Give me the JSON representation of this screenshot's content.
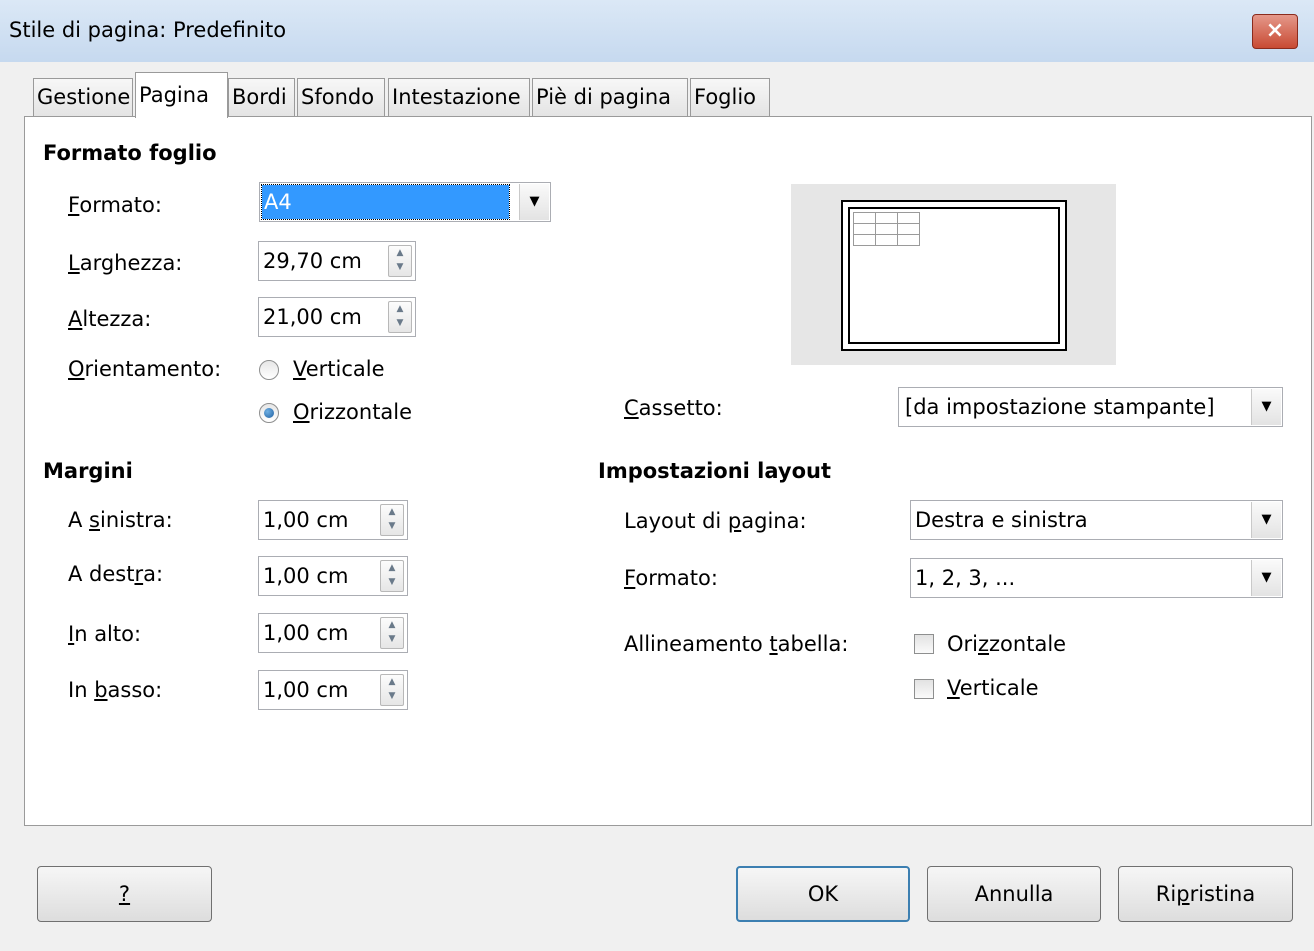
{
  "window": {
    "title": "Stile di pagina: Predefinito",
    "close_glyph": "×"
  },
  "tabs": [
    {
      "label": "Gestione",
      "active": false
    },
    {
      "label": "Pagina",
      "active": true
    },
    {
      "label": "Bordi",
      "active": false
    },
    {
      "label": "Sfondo",
      "active": false
    },
    {
      "label": "Intestazione",
      "active": false
    },
    {
      "label": "Piè di pagina",
      "active": false
    },
    {
      "label": "Foglio",
      "active": false
    }
  ],
  "paper": {
    "heading": "Formato foglio",
    "format": {
      "label_key": "F",
      "label_rest": "ormato:",
      "value": "A4"
    },
    "width": {
      "label_key": "L",
      "label_rest": "arghezza:",
      "value": "29,70 cm"
    },
    "height": {
      "label_key": "A",
      "label_rest": "ltezza:",
      "value": "21,00 cm"
    },
    "orientation": {
      "label_key": "O",
      "label_rest": "rientamento:",
      "portrait_key": "V",
      "portrait_rest": "erticale",
      "landscape_key": "O",
      "landscape_rest": "rizzontale",
      "selected": "landscape"
    },
    "tray": {
      "label_key": "C",
      "label_rest": "assetto:",
      "value": "[da impostazione stampante]"
    }
  },
  "margins": {
    "heading": "Margini",
    "left": {
      "label_pre": "A ",
      "label_key": "s",
      "label_rest": "inistra:",
      "value": "1,00 cm"
    },
    "right": {
      "label_pre": "A dest",
      "label_key": "r",
      "label_rest": "a:",
      "value": "1,00 cm"
    },
    "top": {
      "label_pre": "",
      "label_key": "I",
      "label_rest": "n alto:",
      "value": "1,00 cm"
    },
    "bottom": {
      "label_pre": "In ",
      "label_key": "b",
      "label_rest": "asso:",
      "value": "1,00 cm"
    }
  },
  "layout": {
    "heading": "Impostazioni layout",
    "page_layout": {
      "label_pre": "Layout di ",
      "label_key": "p",
      "label_rest": "agina:",
      "value": "Destra e sinistra"
    },
    "format": {
      "label_key": "F",
      "label_rest": "ormato:",
      "value": "1, 2, 3, ..."
    },
    "table_alignment": {
      "label_pre": "Allineamento ",
      "label_key": "t",
      "label_rest": "abella:",
      "horizontal_pre": "Ori",
      "horizontal_key": "z",
      "horizontal_rest": "zontale",
      "horizontal_checked": false,
      "vertical_key": "V",
      "vertical_rest": "erticale",
      "vertical_checked": false
    }
  },
  "buttons": {
    "help": "?",
    "ok": "OK",
    "cancel": "Annulla",
    "reset_pre": "Ri",
    "reset_key": "p",
    "reset_rest": "ristina"
  },
  "colors": {
    "selection": "#3399ff",
    "titlebar": "#c6d9ef",
    "close": "#c84a33"
  }
}
